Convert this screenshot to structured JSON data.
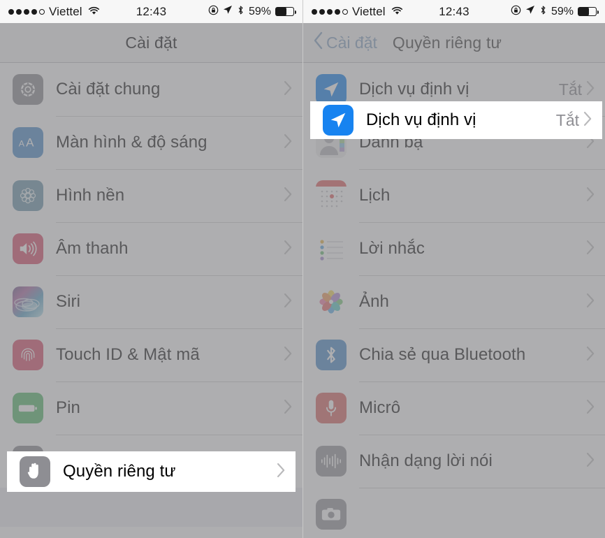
{
  "status_bar": {
    "signal_dots": [
      true,
      true,
      true,
      true,
      false
    ],
    "carrier": "Viettel",
    "wifi_icon": "wifi-icon",
    "time": "12:43",
    "rotation_lock_icon": "rotation-lock-icon",
    "location_icon": "location-arrow-icon",
    "bluetooth_icon": "bluetooth-icon",
    "battery_percent": "59%",
    "battery_icon": "battery-icon",
    "battery_level": 59
  },
  "left_panel": {
    "nav": {
      "title": "Cài đặt"
    },
    "rows": [
      {
        "label": "Cài đặt chung",
        "icon": "gear-icon",
        "chevron": "›"
      },
      {
        "label": "Màn hình & độ sáng",
        "icon": "display-brightness-icon",
        "chevron": "›"
      },
      {
        "label": "Hình nền",
        "icon": "wallpaper-icon",
        "chevron": "›"
      },
      {
        "label": "Âm thanh",
        "icon": "speaker-icon",
        "chevron": "›"
      },
      {
        "label": "Siri",
        "icon": "siri-icon",
        "chevron": "›"
      },
      {
        "label": "Touch ID & Mật mã",
        "icon": "fingerprint-icon",
        "chevron": "›"
      },
      {
        "label": "Pin",
        "icon": "battery-icon",
        "chevron": "›"
      },
      {
        "label": "Quyền riêng tư",
        "icon": "hand-privacy-icon",
        "chevron": "›"
      }
    ],
    "highlighted_row_index": 7
  },
  "right_panel": {
    "nav": {
      "back_label": "Cài đặt",
      "back_icon": "chevron-left-icon",
      "title": "Quyền riêng tư"
    },
    "rows": [
      {
        "label": "Dịch vụ định vị",
        "icon": "location-services-icon",
        "value": "Tắt",
        "chevron": "›"
      },
      {
        "label": "Danh bạ",
        "icon": "contacts-icon",
        "value": "",
        "chevron": "›"
      },
      {
        "label": "Lịch",
        "icon": "calendar-icon",
        "value": "",
        "chevron": "›"
      },
      {
        "label": "Lời nhắc",
        "icon": "reminders-icon",
        "value": "",
        "chevron": "›"
      },
      {
        "label": "Ảnh",
        "icon": "photos-icon",
        "value": "",
        "chevron": "›"
      },
      {
        "label": "Chia sẻ qua Bluetooth",
        "icon": "bluetooth-sharing-icon",
        "value": "",
        "chevron": "›"
      },
      {
        "label": "Micrô",
        "icon": "microphone-icon",
        "value": "",
        "chevron": "›"
      },
      {
        "label": "Nhận dạng lời nói",
        "icon": "speech-recognition-icon",
        "value": "",
        "chevron": "›"
      },
      {
        "label": "",
        "icon": "camera-icon",
        "value": "",
        "chevron": ""
      }
    ],
    "highlighted_row_index": 0
  },
  "colors": {
    "accent_blue": "#007aff",
    "dim_overlay": "#7d7d80",
    "separator": "#d4d4d6",
    "nav_background": "#f7f7f7",
    "value_text": "#8e8e93"
  }
}
